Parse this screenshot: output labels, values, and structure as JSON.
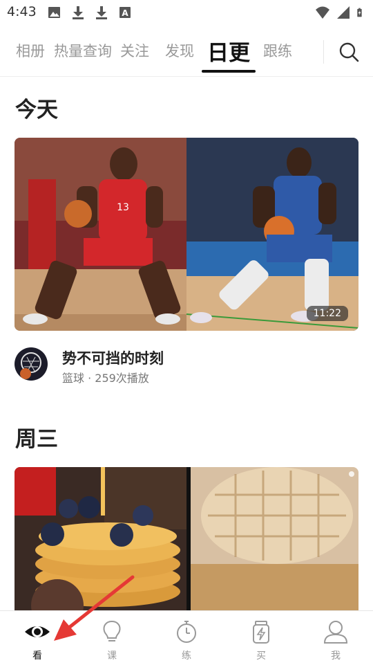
{
  "status_bar": {
    "time": "4:43",
    "icons": [
      "image-icon",
      "download-icon",
      "download-icon",
      "font-a-icon",
      "wifi-icon",
      "signal-icon",
      "battery-charging-icon"
    ]
  },
  "top_nav": {
    "tabs": [
      {
        "label": "相册",
        "active": false
      },
      {
        "label": "热量查询",
        "active": false
      },
      {
        "label": "关注",
        "active": false
      },
      {
        "label": "发现",
        "active": false
      },
      {
        "label": "日更",
        "active": true
      },
      {
        "label": "跟练",
        "active": false
      }
    ],
    "search_icon": "search-icon"
  },
  "sections": [
    {
      "title": "今天",
      "video": {
        "duration": "11:22",
        "title": "势不可挡的时刻",
        "subtitle": "篮球 · 259次播放"
      }
    },
    {
      "title": "周三"
    }
  ],
  "bottom_nav": {
    "items": [
      {
        "label": "看",
        "icon": "eye-icon",
        "active": true
      },
      {
        "label": "课",
        "icon": "lightbulb-icon",
        "active": false
      },
      {
        "label": "练",
        "icon": "stopwatch-icon",
        "active": false
      },
      {
        "label": "买",
        "icon": "shopping-jar-icon",
        "active": false
      },
      {
        "label": "我",
        "icon": "user-icon",
        "active": false
      }
    ]
  },
  "colors": {
    "arrow": "#e53935",
    "active_text": "#111111",
    "inactive_text": "#999999"
  }
}
